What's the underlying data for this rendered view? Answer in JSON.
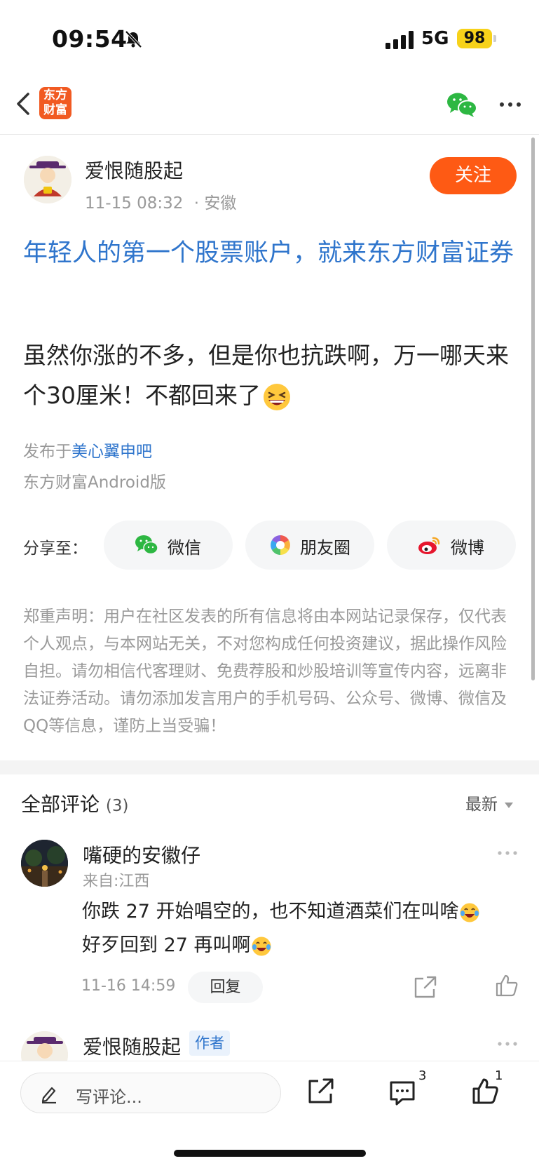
{
  "status_bar": {
    "time": "09:54",
    "network": "5G",
    "battery": "98"
  },
  "nav": {
    "logo_text_line1": "东方",
    "logo_text_line2": "财富"
  },
  "post": {
    "author": "爱恨随股起",
    "date": "11-15 08:32",
    "location": "· 安徽",
    "follow_label": "关注",
    "title": "年轻人的第一个股票账户，就来东方财富证券",
    "body": "虽然你涨的不多，但是你也抗跌啊，万一哪天来个30厘米！不都回来了",
    "published_prefix": "发布于",
    "bar_name": "美心翼申吧",
    "client": "东方财富Android版"
  },
  "share": {
    "label": "分享至：",
    "targets": [
      {
        "label": "微信",
        "icon": "wechat-icon"
      },
      {
        "label": "朋友圈",
        "icon": "moments-icon"
      },
      {
        "label": "微博",
        "icon": "weibo-icon"
      }
    ]
  },
  "disclaimer": "郑重声明：用户在社区发表的所有信息将由本网站记录保存，仅代表个人观点，与本网站无关，不对您构成任何投资建议，据此操作风险自担。请勿相信代客理财、免费荐股和炒股培训等宣传内容，远离非法证券活动。请勿添加发言用户的手机号码、公众号、微博、微信及QQ等信息，谨防上当受骗！",
  "comments": {
    "title": "全部评论",
    "count": "(3)",
    "sort_label": "最新",
    "items": [
      {
        "name": "嘴硬的安徽仔",
        "from": "来自:江西",
        "line1": "你跌 27 开始唱空的，也不知道酒菜们在叫啥",
        "line2": "好歹回到 27 再叫啊",
        "time": "11-16 14:59",
        "reply_label": "回复"
      },
      {
        "name": "爱恨随股起",
        "tag": "作者"
      }
    ]
  },
  "bottom_bar": {
    "placeholder": "写评论...",
    "comment_count": "3",
    "like_count": "1"
  },
  "colors": {
    "accent": "#fe5a14",
    "link": "#2f75cc",
    "logo": "#f15a22"
  }
}
